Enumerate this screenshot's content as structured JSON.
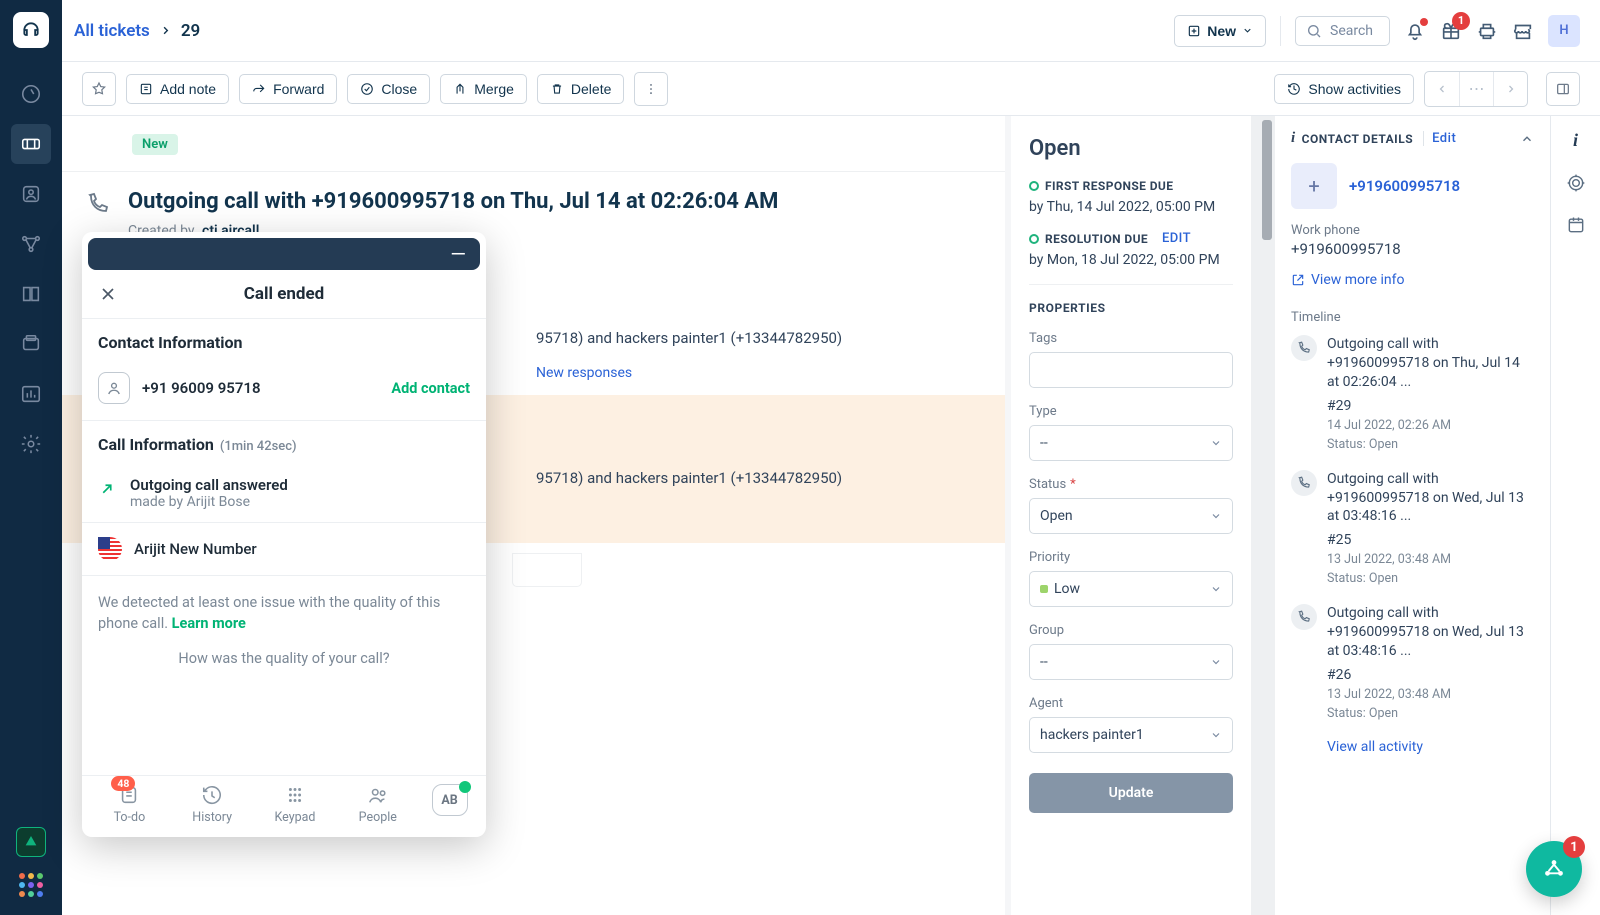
{
  "breadcrumb": {
    "all_tickets": "All tickets",
    "ticket_id": "29"
  },
  "topbar": {
    "new_label": "New",
    "search_placeholder": "Search",
    "gift_badge": "1",
    "avatar_initial": "H"
  },
  "toolbar": {
    "add_note": "Add note",
    "forward": "Forward",
    "close": "Close",
    "merge": "Merge",
    "delete": "Delete",
    "show_activities": "Show activities"
  },
  "ticket": {
    "status_pill": "New",
    "title": "Outgoing call with +919600995718 on Thu, Jul 14 at 02:26:04 AM",
    "created_by_label": "Created by",
    "created_by_agent": "cti aircall",
    "convo_line_a": "95718) and hackers painter1 (+13344782950)",
    "new_responses": "New responses",
    "convo_line_b": "95718) and hackers painter1 (+13344782950)"
  },
  "sla": {
    "open": "Open",
    "first_response_due": "FIRST RESPONSE DUE",
    "first_response_val": "by Thu, 14 Jul 2022, 05:00 PM",
    "resolution_due": "RESOLUTION DUE",
    "edit": "Edit",
    "resolution_val": "by Mon, 18 Jul 2022, 05:00 PM",
    "properties": "PROPERTIES",
    "tags_label": "Tags",
    "type_label": "Type",
    "type_value": "--",
    "status_label": "Status",
    "status_value": "Open",
    "priority_label": "Priority",
    "priority_value": "Low",
    "group_label": "Group",
    "group_value": "--",
    "agent_label": "Agent",
    "agent_value": "hackers painter1",
    "update": "Update"
  },
  "contact": {
    "header": "CONTACT DETAILS",
    "edit": "Edit",
    "phone_link": "+919600995718",
    "avatar_initial": "+",
    "work_phone_label": "Work phone",
    "work_phone_val": "+919600995718",
    "view_more": "View more info",
    "timeline": "Timeline",
    "items": [
      {
        "title": "Outgoing call with +919600995718 on Thu, Jul 14 at 02:26:04 ...",
        "num": "#29",
        "dt": "14 Jul 2022, 02:26 AM",
        "st": "Status: Open"
      },
      {
        "title": "Outgoing call with +919600995718 on Wed, Jul 13 at 03:48:16 ...",
        "num": "#25",
        "dt": "13 Jul 2022, 03:48 AM",
        "st": "Status: Open"
      },
      {
        "title": "Outgoing call with +919600995718 on Wed, Jul 13 at 03:48:16 ...",
        "num": "#26",
        "dt": "13 Jul 2022, 03:48 AM",
        "st": "Status: Open"
      }
    ],
    "view_all": "View all activity"
  },
  "cti": {
    "call_ended": "Call ended",
    "contact_info": "Contact Information",
    "phone_fmt": "+91 96009 95718",
    "add_contact": "Add contact",
    "call_info": "Call Information",
    "call_info_dur": "(1min 42sec)",
    "call_title": "Outgoing call answered",
    "call_sub": "made by Arijit Bose",
    "number_name": "Arijit New Number",
    "notice_a": "We detected at least one issue with the quality of this phone call. ",
    "learn": "Learn more",
    "quality_q": "How was the quality of your call?",
    "todo_badge": "48",
    "tab_todo": "To-do",
    "tab_history": "History",
    "tab_keypad": "Keypad",
    "tab_people": "People",
    "ab": "AB"
  },
  "fab": {
    "badge": "1"
  }
}
